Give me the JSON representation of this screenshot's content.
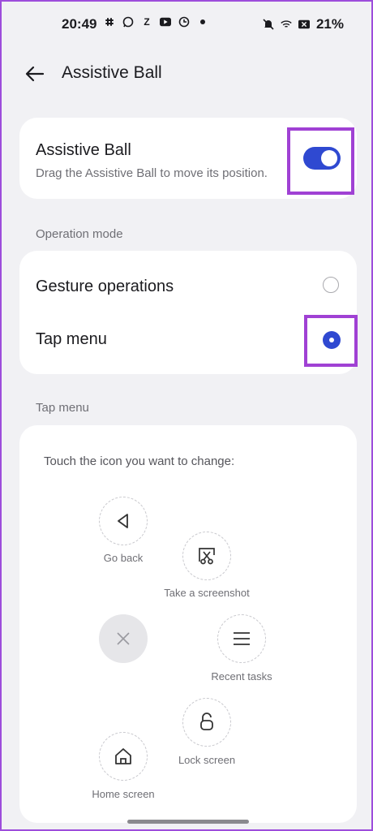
{
  "status_bar": {
    "time": "20:49",
    "battery": "21%",
    "icons_left": [
      "slack-icon",
      "whatsapp-icon",
      "zomato-icon",
      "youtube-icon",
      "sync-icon",
      "dot-icon"
    ],
    "icons_right": [
      "mute-icon",
      "wifi-icon",
      "battery-x-icon"
    ],
    "zomato_glyph": "Z"
  },
  "top_bar": {
    "title": "Assistive Ball"
  },
  "assistive_ball": {
    "title": "Assistive Ball",
    "description": "Drag the Assistive Ball to move its position.",
    "enabled": true
  },
  "operation_mode": {
    "label": "Operation mode",
    "options": [
      {
        "label": "Gesture operations",
        "selected": false
      },
      {
        "label": "Tap menu",
        "selected": true
      }
    ]
  },
  "tap_menu": {
    "section_label": "Tap menu",
    "instruction": "Touch the icon you want to change:",
    "items": [
      {
        "label": "Go back",
        "icon": "back-triangle-icon"
      },
      {
        "label": "Take a screenshot",
        "icon": "screenshot-icon"
      },
      {
        "label": "",
        "icon": "close-icon"
      },
      {
        "label": "Recent tasks",
        "icon": "menu-icon"
      },
      {
        "label": "Lock screen",
        "icon": "lock-icon"
      },
      {
        "label": "Home screen",
        "icon": "home-icon"
      }
    ]
  },
  "colors": {
    "accent": "#2f49d1",
    "highlight": "#a041d4",
    "background": "#f1f1f4"
  }
}
